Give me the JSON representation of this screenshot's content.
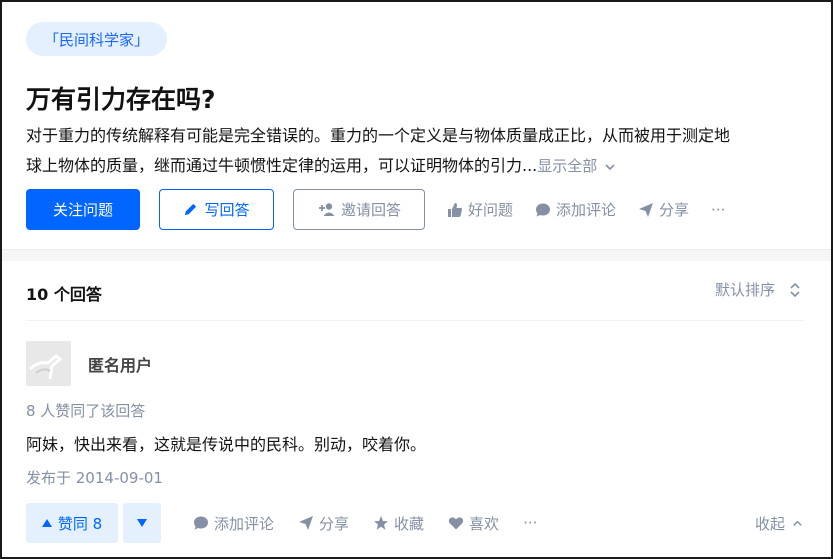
{
  "question": {
    "topic_tag": "「民间科学家」",
    "title": "万有引力存在吗?",
    "detail_line1": "对于重力的传统解释有可能是完全错误的。重力的一个定义是与物体质量成正比，从而被用于测定地",
    "detail_line2": "球上物体的质量，继而通过牛顿惯性定律的运用，可以证明物体的引力...",
    "show_all": "显示全部",
    "actions": {
      "follow": "关注问题",
      "write_answer": "写回答",
      "invite_answer": "邀请回答",
      "good_question": "好问题",
      "add_comment": "添加评论",
      "share": "分享",
      "more": "···"
    }
  },
  "answers_header": {
    "count_label": "10 个回答",
    "sort_label": "默认排序"
  },
  "answer": {
    "author": "匿名用户",
    "votes_text": "8 人赞同了该回答",
    "content": "阿妹，快出来看，这就是传说中的民科。别动，咬着你。",
    "date": "发布于 2014-09-01",
    "actions": {
      "upvote": "赞同 8",
      "add_comment": "添加评论",
      "share": "分享",
      "favorite": "收藏",
      "like": "喜欢",
      "more": "···",
      "collapse": "收起"
    }
  },
  "colors": {
    "brand_blue": "#0066ff",
    "muted_gray": "#8590a6",
    "tag_bg": "#e5f0ff"
  }
}
